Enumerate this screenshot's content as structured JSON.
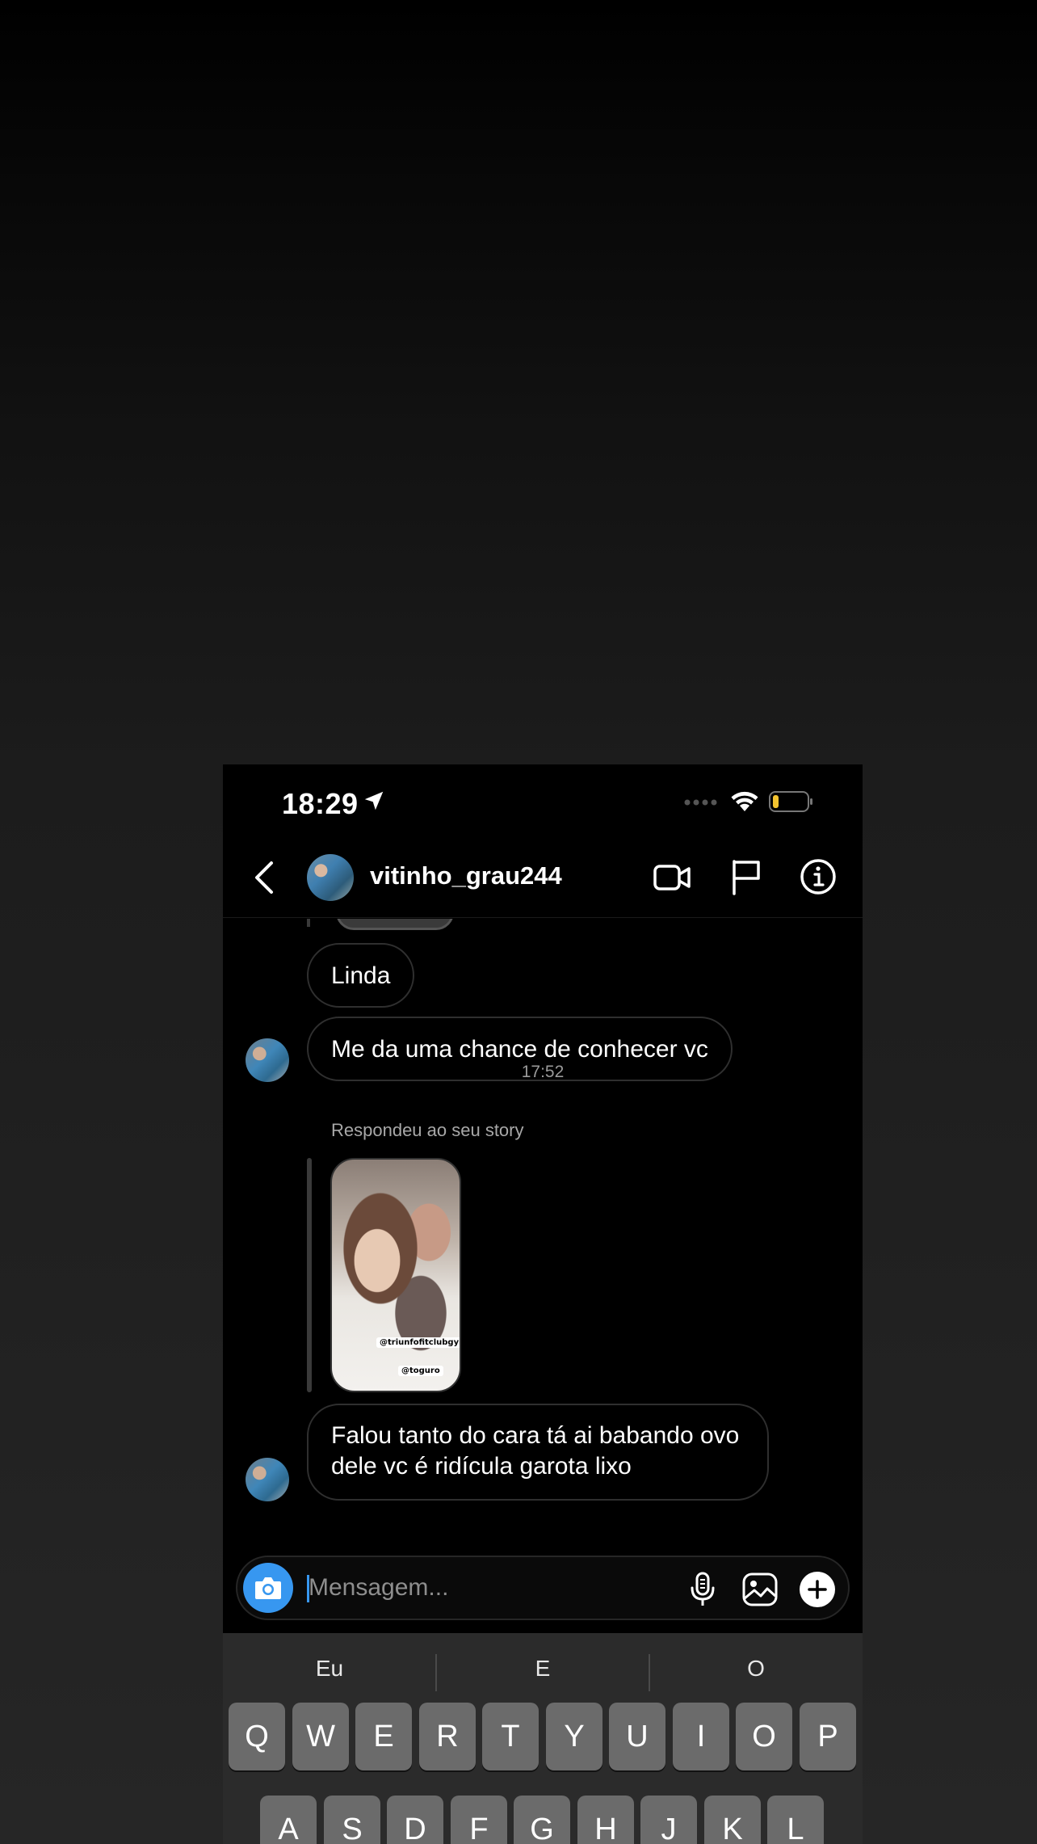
{
  "status_bar": {
    "time": "18:29",
    "icons": [
      "location-arrow-icon",
      "cell-signal-icon",
      "wifi-icon",
      "battery-low-icon"
    ],
    "battery_color": "#f4c430"
  },
  "header": {
    "username": "vitinho_grau244",
    "icons": [
      "back-icon",
      "video-call-icon",
      "flag-icon",
      "info-icon"
    ]
  },
  "messages": {
    "linda": "Linda",
    "chance": "Me da uma chance de conhecer vc",
    "timestamp": "17:52",
    "story_caption": "Respondeu ao seu story",
    "story_tag_1": "@triunfofitclubgym",
    "story_tag_2": "@toguro",
    "falou": "Falou tanto do cara tá ai babando ovo dele vc é ridícula garota lixo"
  },
  "composer": {
    "placeholder": "Mensagem...",
    "value": "",
    "icons": [
      "camera-icon",
      "mic-icon",
      "gallery-icon",
      "plus-icon"
    ],
    "accent": "#3797f0"
  },
  "keyboard": {
    "suggestions": [
      "Eu",
      "E",
      "O"
    ],
    "row1": [
      "Q",
      "W",
      "E",
      "R",
      "T",
      "Y",
      "U",
      "I",
      "O",
      "P"
    ],
    "row2": [
      "A",
      "S",
      "D",
      "F",
      "G",
      "H",
      "J",
      "K",
      "L"
    ]
  }
}
